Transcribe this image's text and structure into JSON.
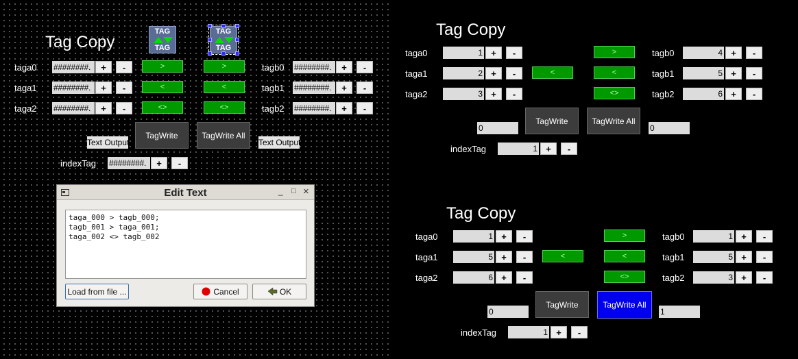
{
  "editor": {
    "title": "Tag Copy",
    "icon_text": "TAG",
    "labels_a": [
      "taga0",
      "taga1",
      "taga2"
    ],
    "labels_b": [
      "tagb0",
      "tagb1",
      "tagb2"
    ],
    "hash": "########.",
    "plus": "+",
    "minus": "-",
    "btn_gt": ">",
    "btn_lt": "<",
    "btn_both": "<>",
    "tagwrite": "TagWrite",
    "tagwrite_all": "TagWrite All",
    "text_output": "Text Output",
    "index_label": "indexTag"
  },
  "dialog": {
    "title": "Edit Text",
    "content": "taga_000 > tagb_000;\ntagb_001 > taga_001;\ntaga_002 <> tagb_002",
    "load_btn": "Load from file ...",
    "cancel_btn": "Cancel",
    "ok_btn": "OK",
    "min": "_",
    "max": "□",
    "close": "×"
  },
  "runtime1": {
    "title": "Tag Copy",
    "labels_a": [
      "taga0",
      "taga1",
      "taga2"
    ],
    "labels_b": [
      "tagb0",
      "tagb1",
      "tagb2"
    ],
    "values_a": [
      "1",
      "2",
      "3"
    ],
    "values_b": [
      "4",
      "5",
      "6"
    ],
    "plus": "+",
    "minus": "-",
    "btn_gt": ">",
    "btn_lt": "<",
    "btn_both": "<>",
    "tagwrite": "TagWrite",
    "tagwrite_all": "TagWrite All",
    "out_left": "0",
    "out_right": "0",
    "index_label": "indexTag",
    "index_value": "1"
  },
  "runtime2": {
    "title": "Tag Copy",
    "labels_a": [
      "taga0",
      "taga1",
      "taga2"
    ],
    "labels_b": [
      "tagb0",
      "tagb1",
      "tagb2"
    ],
    "values_a": [
      "1",
      "5",
      "6"
    ],
    "values_b": [
      "1",
      "5",
      "3"
    ],
    "plus": "+",
    "minus": "-",
    "btn_gt": ">",
    "btn_lt": "<",
    "btn_both": "<>",
    "tagwrite": "TagWrite",
    "tagwrite_all": "TagWrite All",
    "out_left": "0",
    "out_right": "1",
    "index_label": "indexTag",
    "index_value": "1"
  },
  "colors": {
    "green_button": "#009900",
    "blue_active": "#0000ee",
    "dark_button": "#3c3c3c"
  }
}
